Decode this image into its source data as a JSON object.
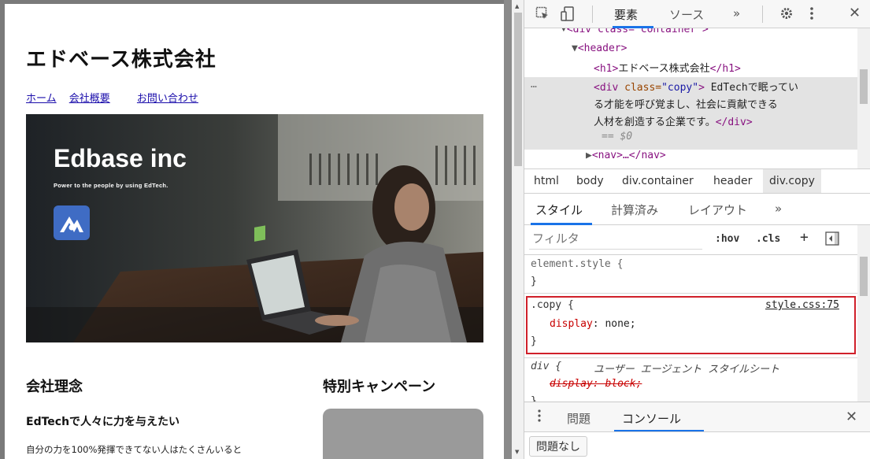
{
  "page": {
    "site_title": "エドベース株式会社",
    "nav": [
      "ホーム",
      "会社概要",
      "お問い合わせ"
    ],
    "hero": {
      "title": "Edbase inc",
      "subtitle": "Power to the people by using EdTech."
    },
    "section_philosophy": "会社理念",
    "section_campaign": "特別キャンペーン",
    "subheading": "EdTechで人々に力を与えたい",
    "body_text": "自分の力を100%発揮できてない人はたくさんいると"
  },
  "devtools": {
    "tabs": [
      "要素",
      "ソース",
      "»"
    ],
    "elements": {
      "line_container": "<div class=\"container\">",
      "header_open": "<header>",
      "h1_open": "<h1>",
      "h1_text": "エドベース株式会社",
      "h1_close": "</h1>",
      "div_open_tag": "<div ",
      "div_attr": "class=",
      "div_attr_val": "\"copy\"",
      "div_close_bracket": ">",
      "div_text_1": " EdTechで眠ってい",
      "div_text_2": "る才能を呼び覚まし、社会に貢献できる",
      "div_text_3": "人材を創造する企業です。",
      "div_close": "</div>",
      "eq": "== $0",
      "nav": "<nav>…</nav>",
      "ellipsis": "…"
    },
    "breadcrumbs": [
      "html",
      "body",
      "div.container",
      "header",
      "div.copy"
    ],
    "subtabs": [
      "スタイル",
      "計算済み",
      "レイアウト",
      "»"
    ],
    "filter_placeholder": "フィルタ",
    "filter_buttons": [
      ":hov",
      ".cls",
      "+"
    ],
    "styles": {
      "element_style": "element.style {",
      "close_brace": "}",
      "copy_selector": ".copy {",
      "copy_source": "style.css:75",
      "copy_prop": "display",
      "copy_val": "none;",
      "ua_selector": "div {",
      "ua_label": "ユーザー エージェント スタイルシート",
      "ua_prop": "display: block;"
    },
    "drawer_tabs": [
      "問題",
      "コンソール"
    ],
    "issues_button": "問題なし",
    "colors": {
      "accent": "#1a73e8",
      "highlight_border": "#d0202a"
    }
  }
}
